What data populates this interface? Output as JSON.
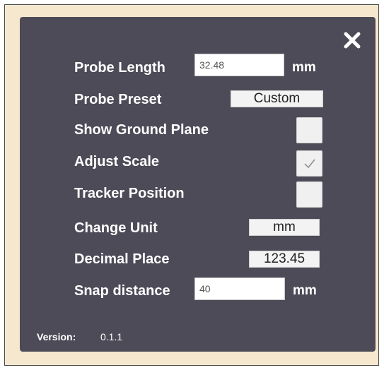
{
  "settings": {
    "close_icon": "close-icon",
    "probe_length": {
      "label": "Probe Length",
      "value": "32.48",
      "unit": "mm"
    },
    "probe_preset": {
      "label": "Probe Preset",
      "value": "Custom"
    },
    "show_ground_plane": {
      "label": "Show Ground Plane",
      "checked": false
    },
    "adjust_scale": {
      "label": "Adjust Scale",
      "checked": true,
      "check_icon": "checkmark-icon"
    },
    "tracker_position": {
      "label": "Tracker Position",
      "checked": false
    },
    "change_unit": {
      "label": "Change Unit",
      "value": "mm"
    },
    "decimal_place": {
      "label": "Decimal Place",
      "value": "123.45"
    },
    "snap_distance": {
      "label": "Snap distance",
      "value": "40",
      "unit": "mm"
    },
    "version": {
      "label": "Version:",
      "value": "0.1.1"
    }
  },
  "colors": {
    "panel_background": "#4e4b58",
    "frame_background": "#f6e8cf",
    "label_text": "#ffffff",
    "control_background": "#f3f3f3"
  }
}
